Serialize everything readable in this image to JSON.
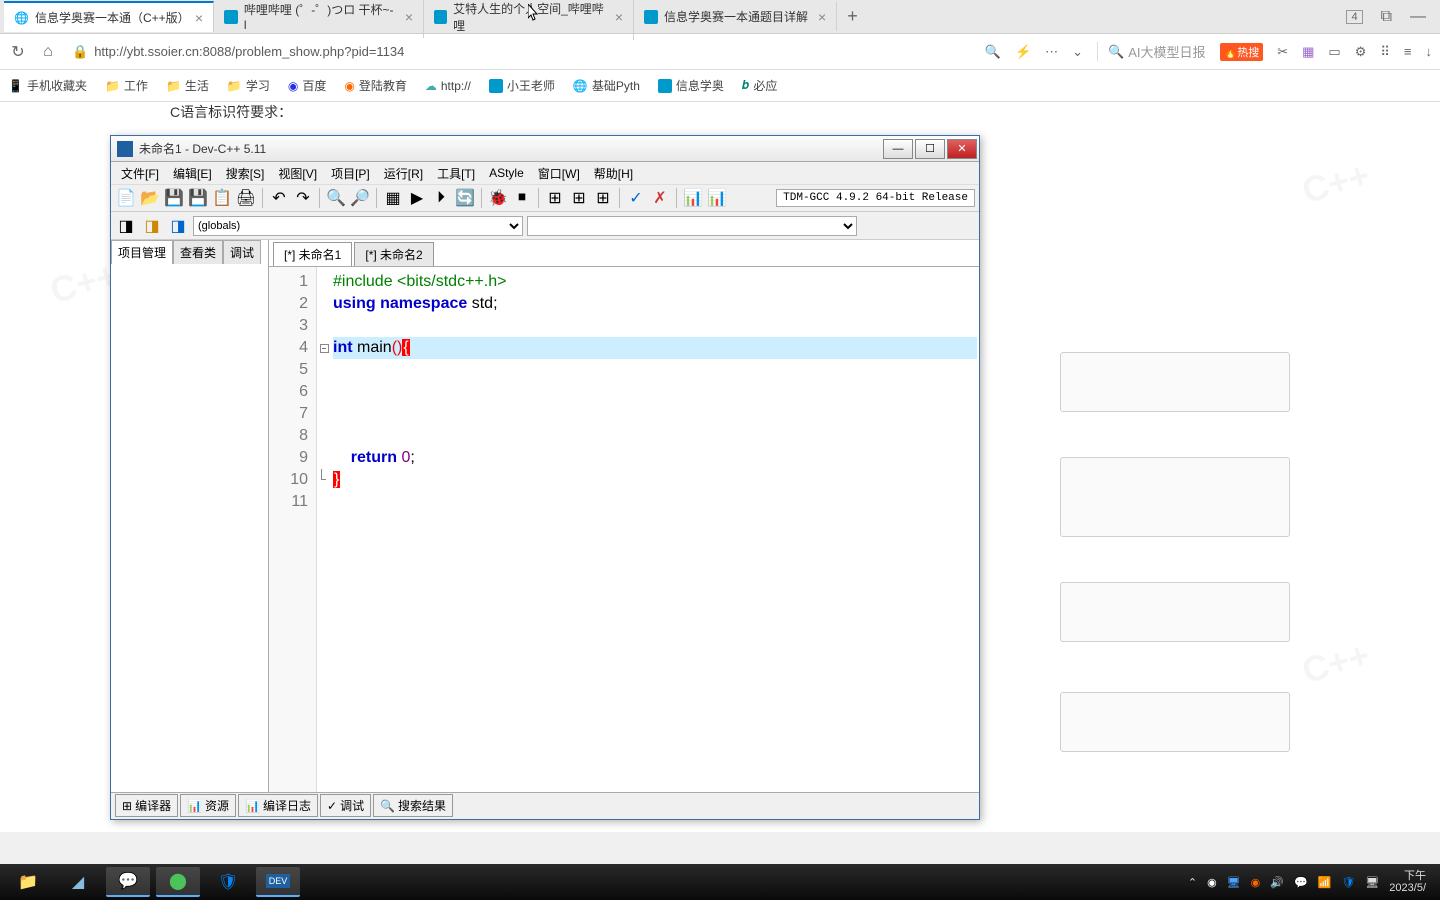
{
  "browser": {
    "tabs": [
      {
        "label": "信息学奥赛一本通（C++版）",
        "active": true
      },
      {
        "label": "哔哩哔哩 (゜-゜)つロ 干杯~-l"
      },
      {
        "label": "艾特人生的个人空间_哔哩哔哩"
      },
      {
        "label": "信息学奥赛一本通题目详解"
      }
    ],
    "tabs_count": "4",
    "url": "http://ybt.ssoier.cn:8088/problem_show.php?pid=1134",
    "search_placeholder": "AI大模型日报",
    "hot_label": "热搜"
  },
  "bookmarks": [
    "手机收藏夹",
    "工作",
    "生活",
    "学习",
    "百度",
    "登陆教育",
    "http://",
    "小王老师",
    "基础Pyth",
    "信息学奥",
    "必应"
  ],
  "page_hint": "C语言标识符要求：",
  "watermark": "C++",
  "devcpp": {
    "title": "未命名1 - Dev-C++ 5.11",
    "menus": [
      "文件[F]",
      "编辑[E]",
      "搜索[S]",
      "视图[V]",
      "项目[P]",
      "运行[R]",
      "工具[T]",
      "AStyle",
      "窗口[W]",
      "帮助[H]"
    ],
    "compiler": "TDM-GCC 4.9.2 64-bit Release",
    "scope_combo": "(globals)",
    "left_tabs": [
      "项目管理",
      "查看类",
      "调试"
    ],
    "file_tabs": [
      "[*] 未命名1",
      "[*] 未命名2"
    ],
    "bottom_tabs": [
      "编译器",
      "资源",
      "编译日志",
      "调试",
      "搜索结果"
    ],
    "code": {
      "l1_a": "#include ",
      "l1_b": "<bits/stdc++.h>",
      "l2_a": "using ",
      "l2_b": "namespace ",
      "l2_c": "std",
      "l2_d": ";",
      "l4_a": "int ",
      "l4_b": "main",
      "l4_c": "(",
      "l4_d": ")",
      "l4_e": "{",
      "l9_a": "    return ",
      "l9_b": "0",
      "l9_c": ";",
      "l10": "}"
    },
    "line_numbers": [
      "1",
      "2",
      "3",
      "4",
      "5",
      "6",
      "7",
      "8",
      "9",
      "10",
      "11"
    ]
  },
  "taskbar": {
    "time": "下午",
    "date": "2023/5/"
  }
}
